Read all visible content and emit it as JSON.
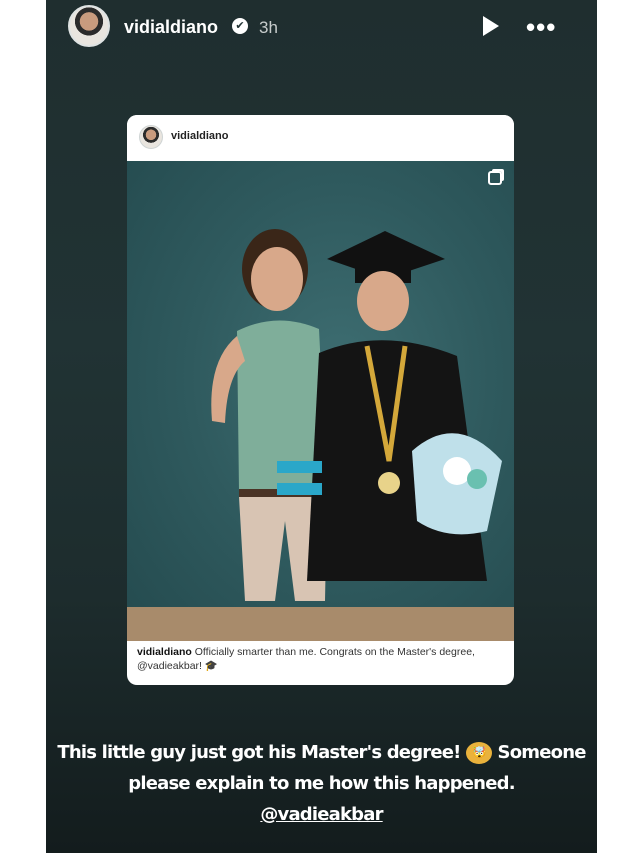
{
  "header": {
    "username": "vidialdiano",
    "time": "3h",
    "verified_glyph": "✔",
    "play_icon": "play-icon",
    "more_icon": "more-icon",
    "more_glyph": "•••"
  },
  "repost": {
    "username": "vidialdiano",
    "caption_user": "vidialdiano",
    "caption_text": "Officially smarter than me. Congrats on the Master's degree, @vadieakbar! 🎓"
  },
  "story_text": {
    "line1_a": "This little guy just got his Master's degree!",
    "emoji": "🤯",
    "line1_b": "Someone",
    "line2": "please explain to me how this happened.",
    "mention": "@vadieakbar"
  },
  "colors": {
    "story_bg": "#1f2e2f",
    "gown_accent": "#2aa7c9",
    "medal": "#d4a83a"
  }
}
